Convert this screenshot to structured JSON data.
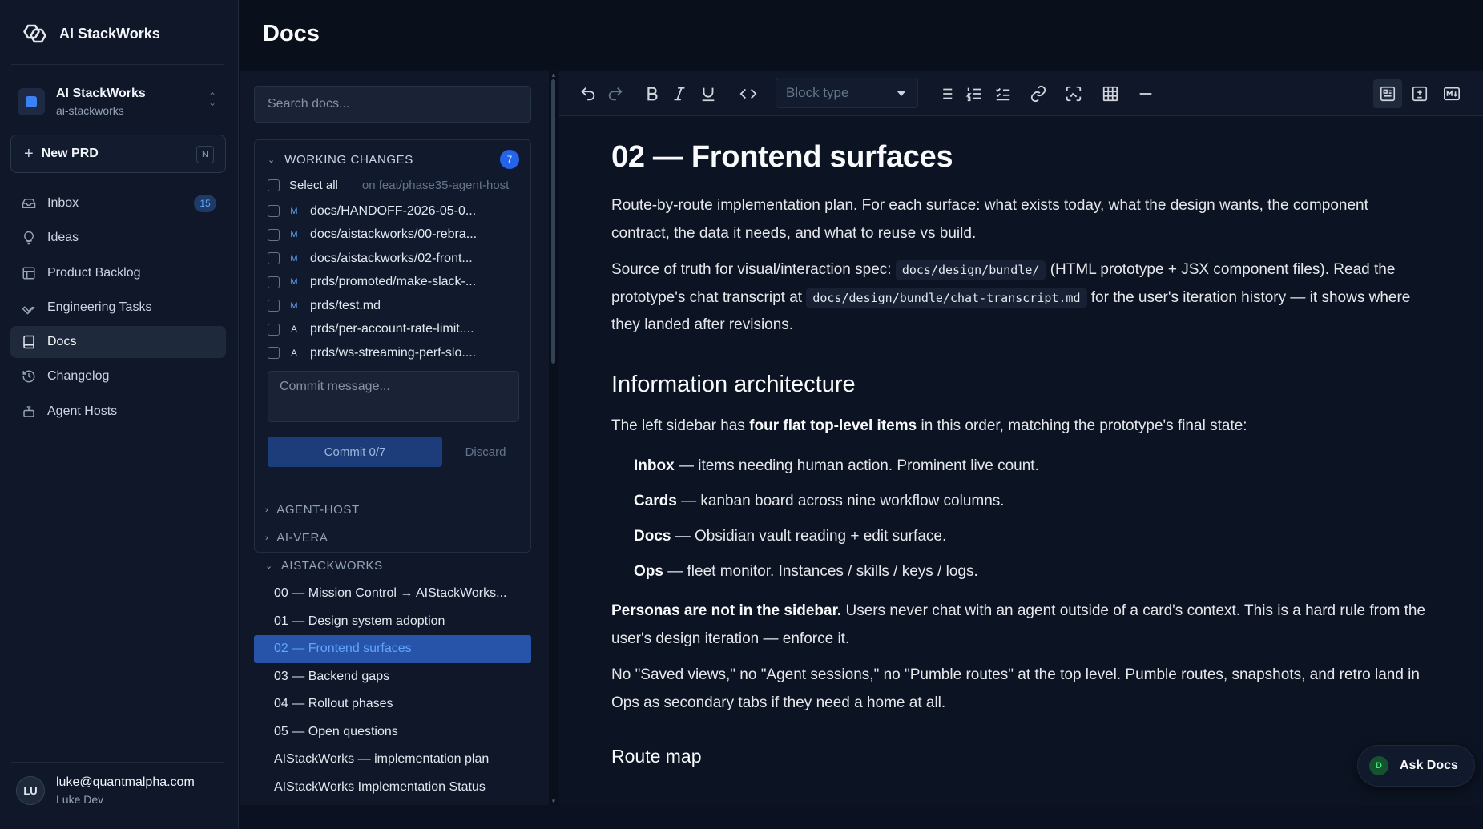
{
  "app": {
    "brand_name": "AI StackWorks",
    "workspace_name": "AI StackWorks",
    "workspace_slug": "ai-stackworks"
  },
  "new_prd": {
    "label": "New PRD",
    "shortcut": "N"
  },
  "nav": [
    {
      "label": "Inbox",
      "icon": "inbox-icon",
      "badge": "15"
    },
    {
      "label": "Ideas",
      "icon": "lightbulb-icon"
    },
    {
      "label": "Product Backlog",
      "icon": "layout-icon"
    },
    {
      "label": "Engineering Tasks",
      "icon": "wrench-icon"
    },
    {
      "label": "Docs",
      "icon": "book-icon",
      "active": true
    },
    {
      "label": "Changelog",
      "icon": "history-icon"
    },
    {
      "label": "Agent Hosts",
      "icon": "robot-icon"
    }
  ],
  "user": {
    "initials": "LU",
    "email": "luke@quantmalpha.com",
    "name": "Luke Dev"
  },
  "header": {
    "title": "Docs"
  },
  "docpane": {
    "search_placeholder": "Search docs...",
    "changes": {
      "title": "WORKING CHANGES",
      "count": "7",
      "select_all": "Select all",
      "branch": "on feat/phase35-agent-host",
      "files": [
        {
          "status": "M",
          "path": "docs/HANDOFF-2026-05-0..."
        },
        {
          "status": "M",
          "path": "docs/aistackworks/00-rebra..."
        },
        {
          "status": "M",
          "path": "docs/aistackworks/02-front..."
        },
        {
          "status": "M",
          "path": "prds/promoted/make-slack-..."
        },
        {
          "status": "M",
          "path": "prds/test.md"
        },
        {
          "status": "A",
          "path": "prds/per-account-rate-limit...."
        },
        {
          "status": "A",
          "path": "prds/ws-streaming-perf-slo...."
        }
      ],
      "commit_placeholder": "Commit message...",
      "commit_label": "Commit 0/7",
      "discard_label": "Discard"
    },
    "groups": [
      {
        "label": "AGENT-HOST",
        "expanded": false
      },
      {
        "label": "AI-VERA",
        "expanded": false
      },
      {
        "label": "AISTACKWORKS",
        "expanded": true
      }
    ],
    "docs": [
      {
        "label": "00 — Mission Control → AIStackWorks..."
      },
      {
        "label": "01 — Design system adoption"
      },
      {
        "label": "02 — Frontend surfaces",
        "active": true
      },
      {
        "label": "03 — Backend gaps"
      },
      {
        "label": "04 — Rollout phases"
      },
      {
        "label": "05 — Open questions"
      },
      {
        "label": "AIStackWorks — implementation plan"
      },
      {
        "label": "AIStackWorks Implementation Status"
      }
    ]
  },
  "editor": {
    "block_type_placeholder": "Block type",
    "toolbar_icons": [
      "undo-icon",
      "redo-icon",
      "bold-icon",
      "italic-icon",
      "underline-icon",
      "code-icon",
      "bullet-list-icon",
      "numbered-list-icon",
      "checklist-icon",
      "link-icon",
      "image-icon",
      "table-icon",
      "horizontal-rule-icon",
      "rich-text-mode-icon",
      "diff-mode-icon",
      "markdown-mode-icon"
    ],
    "doc": {
      "h1": "02 — Frontend surfaces",
      "p1": "Route-by-route implementation plan. For each surface: what exists today, what the design wants, the component contract, the data it needs, and what to reuse vs build.",
      "p2_a": "Source of truth for visual/interaction spec: ",
      "p2_code1": "docs/design/bundle/",
      "p2_b": " (HTML prototype + JSX component files). Read the prototype's chat transcript at ",
      "p2_code2": "docs/design/bundle/chat-transcript.md",
      "p2_c": " for the user's iteration history — it shows where they landed after revisions.",
      "h2": "Information architecture",
      "p3_a": "The left sidebar has ",
      "p3_b": "four flat top-level items",
      "p3_c": " in this order, matching the prototype's final state:",
      "items": [
        {
          "term": "Inbox",
          "desc": " — items needing human action. Prominent live count."
        },
        {
          "term": "Cards",
          "desc": " — kanban board across nine workflow columns."
        },
        {
          "term": "Docs",
          "desc": " — Obsidian vault reading + edit surface."
        },
        {
          "term": "Ops",
          "desc": " — fleet monitor. Instances / skills / keys / logs."
        }
      ],
      "p4_a": "Personas are not in the sidebar.",
      "p4_b": " Users never chat with an agent outside of a card's context. This is a hard rule from the user's design iteration — enforce it.",
      "p5": "No \"Saved views,\" no \"Agent sessions,\" no \"Pumble routes\" at the top level. Pumble routes, snapshots, and retro land in Ops as secondary tabs if they need a home at all.",
      "h3": "Route map"
    }
  },
  "ask_docs": {
    "initial": "D",
    "label": "Ask Docs"
  },
  "colors": {
    "accent": "#2563eb",
    "active_doc_bg": "#2754a9",
    "badge_bg": "#1e3a66"
  }
}
